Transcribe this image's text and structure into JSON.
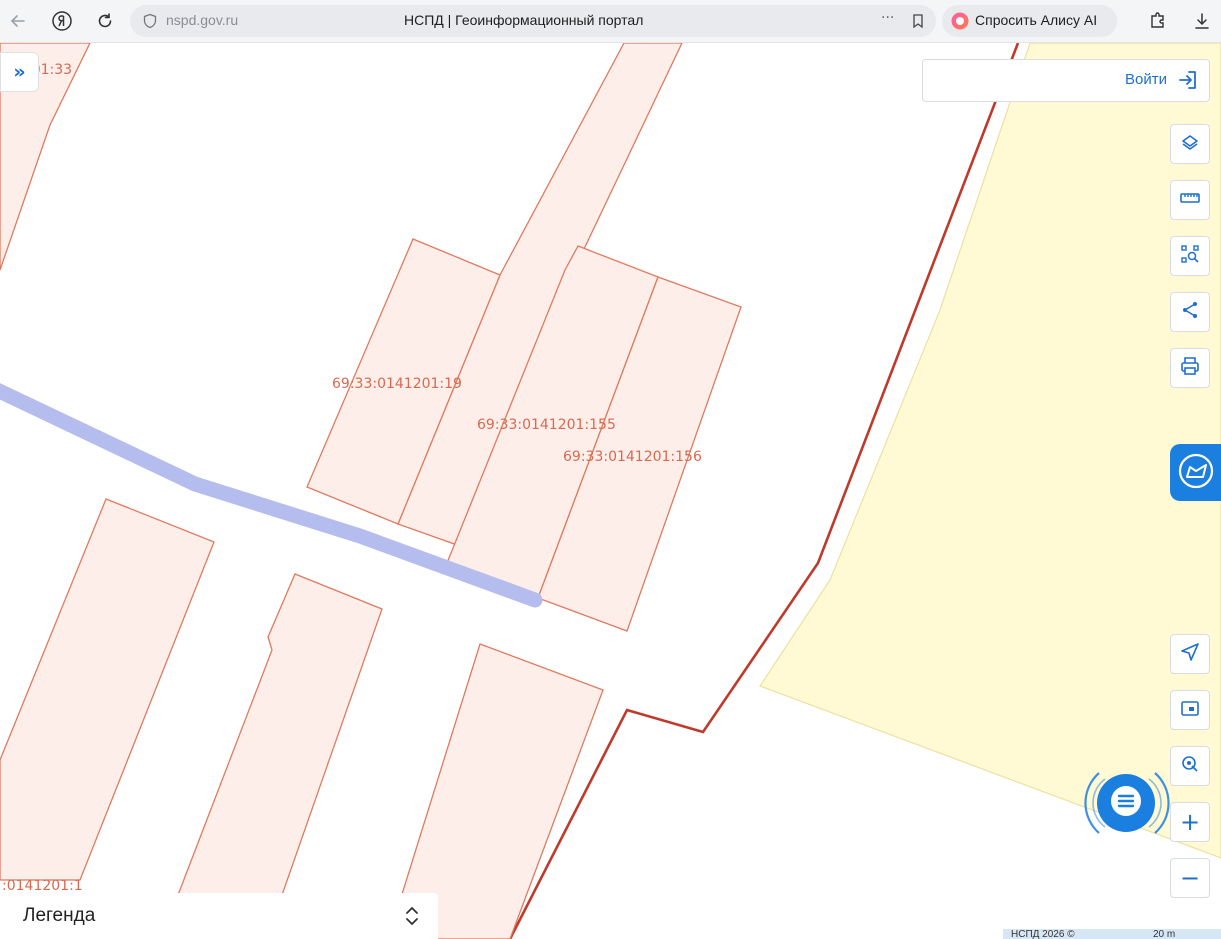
{
  "browser": {
    "url": "nspd.gov.ru",
    "title": "НСПД | Геоинформационный портал",
    "alice_label": "Спросить Алису AI",
    "more_glyph": "···"
  },
  "map": {
    "parcels": [
      {
        "id": "p19",
        "label": "69:33:0141201:19"
      },
      {
        "id": "p155",
        "label": "69:33:0141201:155"
      },
      {
        "id": "p156",
        "label": "69:33:0141201:156"
      },
      {
        "id": "p33-partial",
        "label": ":01:33"
      },
      {
        "id": "p1-partial",
        "label": ":0141201:1"
      }
    ],
    "colors": {
      "parcel_fill": "#fdeee9",
      "parcel_stroke": "#e07a5f",
      "label": "#d9694f",
      "boundary": "#c0392b",
      "zone_fill": "#fff9d4",
      "road": "#b4bdee"
    }
  },
  "controls": {
    "login_label": "Войти",
    "tools": [
      {
        "name": "layers-icon"
      },
      {
        "name": "ruler-icon"
      },
      {
        "name": "area-select-icon"
      },
      {
        "name": "share-icon"
      },
      {
        "name": "print-icon"
      }
    ],
    "nav": [
      {
        "name": "locate-icon"
      },
      {
        "name": "map-frame-icon"
      },
      {
        "name": "geolocation-icon"
      },
      {
        "name": "zoom-in-icon",
        "glyph": "+"
      },
      {
        "name": "zoom-out-icon",
        "glyph": "−"
      }
    ]
  },
  "legend": {
    "label": "Легенда"
  },
  "footer": {
    "copyright": "НСПД 2026 ©",
    "scale": "20 m"
  }
}
